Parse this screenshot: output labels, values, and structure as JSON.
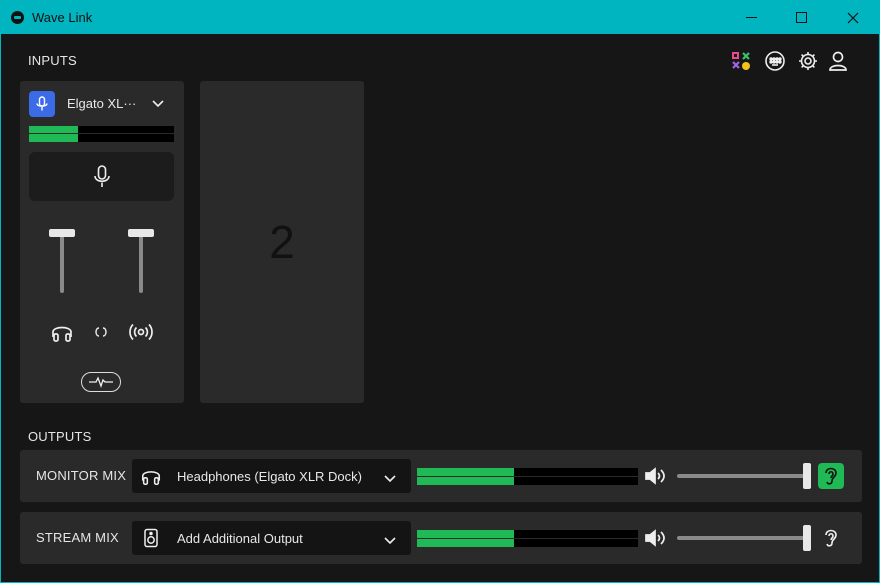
{
  "window": {
    "title": "Wave Link"
  },
  "colors": {
    "accent": "#00b4c0",
    "meter": "#1fb955",
    "mic_badge": "#3b6be6"
  },
  "inputs": {
    "section_label": "INPUTS",
    "channels": [
      {
        "name": "Elgato XL···",
        "level": 0.34,
        "monitor_fader": 1.0,
        "stream_fader": 1.0,
        "icons": [
          "headphones-icon",
          "link-icon",
          "broadcast-icon",
          "effects-icon"
        ]
      }
    ],
    "empty_slot_label": "2"
  },
  "toolbar_icons": [
    "marketplace-icon",
    "keyboard-icon",
    "settings-icon",
    "account-icon"
  ],
  "outputs": {
    "section_label": "OUTPUTS",
    "rows": [
      {
        "label": "MONITOR MIX",
        "device": "Headphones (Elgato XLR Dock)",
        "device_icon": "headphones-icon",
        "level": 0.44,
        "volume": 1.0,
        "listen_active": true
      },
      {
        "label": "STREAM MIX",
        "device": "Add Additional Output",
        "device_icon": "speaker-icon",
        "level": 0.44,
        "volume": 1.0,
        "listen_active": false
      }
    ]
  }
}
